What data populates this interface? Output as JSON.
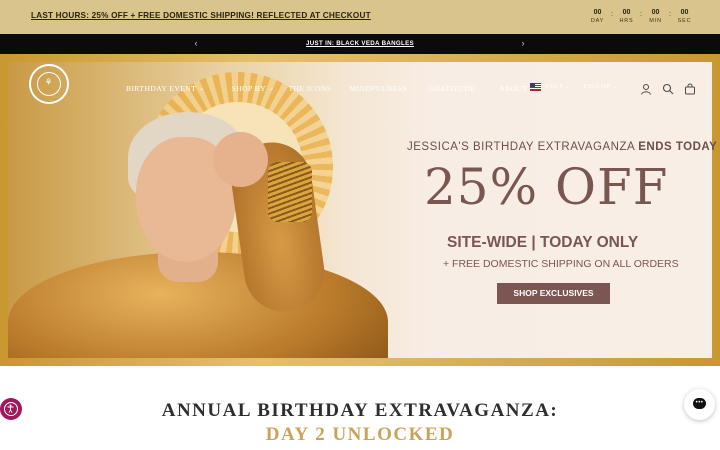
{
  "promo": {
    "text": "LAST HOURS: 25% OFF + FREE DOMESTIC SHIPPING! REFLECTED AT CHECKOUT",
    "countdown": [
      {
        "value": "00",
        "label": "DAY"
      },
      {
        "value": "00",
        "label": "HRS"
      },
      {
        "value": "00",
        "label": "MIN"
      },
      {
        "value": "00",
        "label": "SEC"
      }
    ],
    "separator": ":"
  },
  "announcement": {
    "text": "JUST IN: BLACK VEDA BANGLES",
    "prev_icon": "‹",
    "next_icon": "›"
  },
  "header": {
    "logo_glyph": "⚘",
    "nav": [
      {
        "label": "BIRTHDAY EVENT",
        "chevron": "⌄"
      },
      {
        "label": "SHOP BY",
        "chevron": "⌄"
      },
      {
        "label": "THE ICONS",
        "chevron": ""
      },
      {
        "label": "MINDFULNESS",
        "chevron": ""
      },
      {
        "label": "GRATITUDE",
        "chevron": ""
      },
      {
        "label": "ABOUT",
        "chevron": ""
      }
    ],
    "currency": "USD $",
    "language": "ENGLISH",
    "chevron": "⌄",
    "icons": {
      "account": "account-icon",
      "search": "search-icon",
      "cart": "cart-icon"
    }
  },
  "hero": {
    "kicker_prefix": "JESSICA'S BIRTHDAY EXTRAVAGANZA ",
    "kicker_bold": "ENDS TODAY",
    "headline": "25% OFF",
    "subheadline": "SITE-WIDE | TODAY ONLY",
    "subline": "+ FREE DOMESTIC SHIPPING ON ALL ORDERS",
    "cta": "SHOP EXCLUSIVES"
  },
  "section": {
    "title": "ANNUAL BIRTHDAY EXTRAVAGANZA:",
    "subtitle": "DAY 2 UNLOCKED"
  },
  "widgets": {
    "accessibility_icon": "accessibility-icon",
    "chat_icon": "chat-icon"
  },
  "colors": {
    "promo_bg": "#d9c48b",
    "announce_bg": "#0b0b0b",
    "accent": "#7b5652",
    "gold_text": "#c9a35a",
    "a11y": "#a0195c"
  }
}
